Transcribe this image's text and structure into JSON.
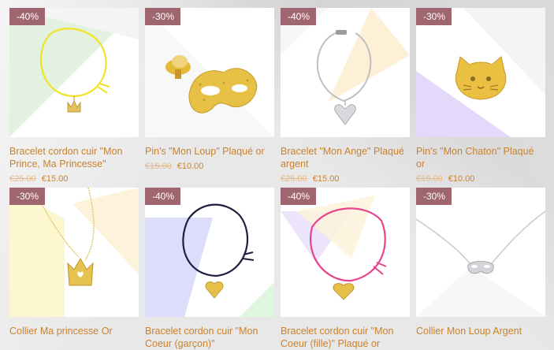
{
  "products": [
    {
      "badge": "-40%",
      "title": "Bracelet cordon cuir \"Mon Prince, Ma Princesse\"",
      "old_price": "€25.00",
      "new_price": "€15.00",
      "image_icon": "yellow-cord-bracelet-crown-icon"
    },
    {
      "badge": "-30%",
      "title": "Pin's \"Mon Loup\" Plaqué or",
      "old_price": "€15.00",
      "new_price": "€10.00",
      "image_icon": "gold-mask-pin-icon"
    },
    {
      "badge": "-40%",
      "title": "Bracelet \"Mon Ange\" Plaqué argent",
      "old_price": "€25.00",
      "new_price": "€15.00",
      "image_icon": "silver-heart-bracelet-icon"
    },
    {
      "badge": "-30%",
      "title": "Pin's \"Mon Chaton\" Plaqué or",
      "old_price": "€15.00",
      "new_price": "€10.00",
      "image_icon": "gold-kitten-pin-icon"
    },
    {
      "badge": "-30%",
      "title": "Collier Ma princesse Or",
      "old_price": "",
      "new_price": "",
      "image_icon": "gold-crown-necklace-icon"
    },
    {
      "badge": "-40%",
      "title": "Bracelet cordon cuir \"Mon Coeur (garçon)\"",
      "old_price": "",
      "new_price": "",
      "image_icon": "navy-cord-heart-bracelet-icon"
    },
    {
      "badge": "-40%",
      "title": "Bracelet cordon cuir \"Mon Coeur (fille)\" Plaqué or",
      "old_price": "",
      "new_price": "",
      "image_icon": "pink-cord-heart-bracelet-icon"
    },
    {
      "badge": "-30%",
      "title": "Collier Mon Loup Argent",
      "old_price": "",
      "new_price": "",
      "image_icon": "silver-mask-necklace-icon"
    }
  ],
  "colors": {
    "badge": "#a0666f",
    "title": "#c9822d",
    "old_price": "#e2b98b"
  }
}
